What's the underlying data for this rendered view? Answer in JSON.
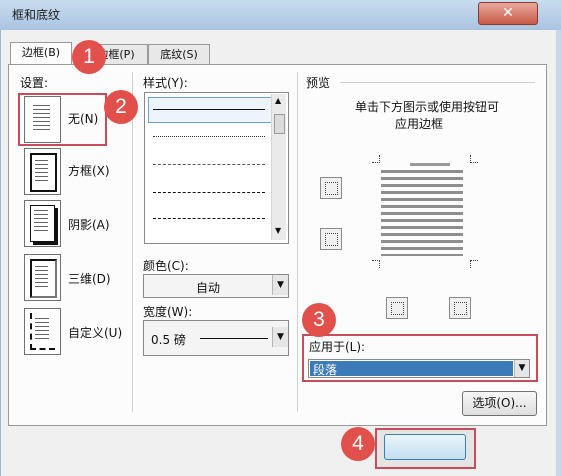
{
  "window": {
    "title": "框和底纹",
    "close_glyph": "✕"
  },
  "tabs": [
    {
      "label": "边框(B)",
      "active": true
    },
    {
      "label": "边框(P)",
      "active": false
    },
    {
      "label": "底纹(S)",
      "active": false
    }
  ],
  "settings": {
    "label": "设置:",
    "items": [
      {
        "label": "无(N)",
        "icon": "setting-none-icon",
        "selected": true
      },
      {
        "label": "方框(X)",
        "icon": "setting-box-icon",
        "selected": false
      },
      {
        "label": "阴影(A)",
        "icon": "setting-shadow-icon",
        "selected": false
      },
      {
        "label": "三维(D)",
        "icon": "setting-3d-icon",
        "selected": false
      },
      {
        "label": "自定义(U)",
        "icon": "setting-custom-icon",
        "selected": false
      }
    ]
  },
  "style": {
    "label": "样式(Y):",
    "options": [
      "solid",
      "dotted",
      "dashed-fine",
      "dashed",
      "dash-dot",
      "dash-dot-dot"
    ]
  },
  "color": {
    "label": "颜色(C):",
    "value": "自动"
  },
  "width": {
    "label": "宽度(W):",
    "value": "0.5 磅"
  },
  "preview": {
    "label": "预览",
    "hint_line1": "单击下方图示或使用按钮可",
    "hint_line2": "应用边框"
  },
  "apply_to": {
    "label": "应用于(L):",
    "value": "段落",
    "highlight_color": "#3d7ab8"
  },
  "buttons": {
    "options": "选项(O)..."
  },
  "step_markers": [
    "1",
    "2",
    "3",
    "4"
  ],
  "colors": {
    "marker": "#e2504c",
    "marker_box": "#c84c5a"
  }
}
